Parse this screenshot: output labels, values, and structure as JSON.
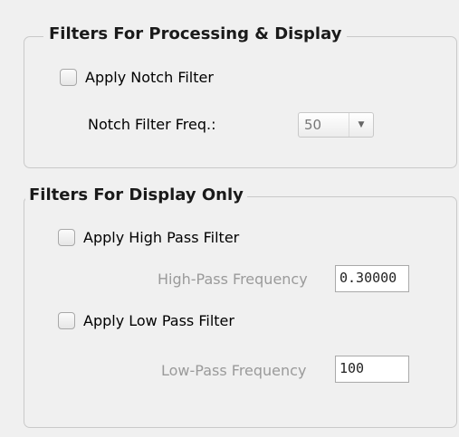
{
  "group_processing": {
    "title": "Filters For Processing & Display",
    "notch_checkbox_label": "Apply Notch Filter",
    "notch_checked": false,
    "notch_freq_label": "Notch Filter Freq.:",
    "notch_freq_value": "50",
    "dropdown_icon": "chevron-down-icon"
  },
  "group_display": {
    "title": "Filters For Display Only",
    "highpass_checkbox_label": "Apply High Pass Filter",
    "highpass_checked": false,
    "highpass_freq_label": "High-Pass Frequency",
    "highpass_freq_value": "0.30000",
    "lowpass_checkbox_label": "Apply Low Pass Filter",
    "lowpass_checked": false,
    "lowpass_freq_label": "Low-Pass Frequency",
    "lowpass_freq_value": "100"
  },
  "colors": {
    "background": "#f0f0f0",
    "group_border": "#c9c9c9",
    "disabled_text": "#9a9a9a"
  }
}
